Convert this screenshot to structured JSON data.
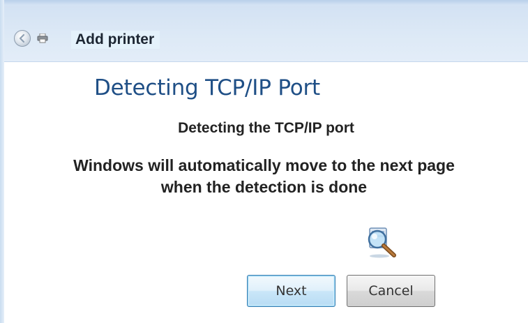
{
  "window": {
    "title": "Add printer"
  },
  "icons": {
    "back": "back-arrow-icon",
    "printer": "printer-icon",
    "detecting": "magnifier-search-icon"
  },
  "page": {
    "heading": "Detecting TCP/IP Port",
    "subheading": "Detecting the TCP/IP port",
    "message_line1": "Windows will automatically move to the next page",
    "message_line2": "when the detection is done"
  },
  "buttons": {
    "next_label": "Next",
    "cancel_label": "Cancel"
  },
  "colors": {
    "heading": "#1f4f86",
    "titlebar": "#dde9f6",
    "next_button_border": "#3c7fb1"
  }
}
